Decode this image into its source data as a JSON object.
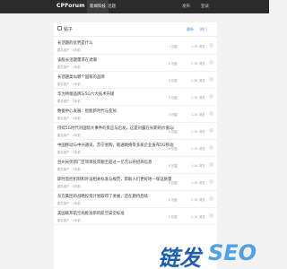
{
  "header": {
    "logo": "CPForum",
    "nav": [
      {
        "label": "新闻科技"
      },
      {
        "label": "话题"
      }
    ],
    "user": [
      "发布",
      "登录"
    ]
  },
  "panel": {
    "title": "帖子",
    "sort": [
      "最新",
      "热门"
    ]
  },
  "rows": [
    {
      "title": "长话题的优势是什么",
      "meta": "匿名用户 · 1年前",
      "replies": "1 回复",
      "views": "1.7K 浏览"
    },
    {
      "title": "该股长话题需求在退潮",
      "meta": "匿名用户 · 1年前",
      "replies": "0 回复",
      "views": "1.1K 浏览"
    },
    {
      "title": "长话题类似哪个国家的品牌",
      "meta": "匿名用户 · 1年前",
      "replies": "3 回复",
      "views": "1.3K 浏览"
    },
    {
      "title": "华为终端品牌与5G六大技术升级",
      "meta": "匿名用户 · 1年前",
      "replies": "0 回复",
      "views": "1.1K 浏览"
    },
    {
      "title": "数据中心发展：智能新时代与变局",
      "meta": "匿名用户 · 1年前",
      "replies": "0 回复",
      "views": "1.1K 浏览"
    },
    {
      "title": "持续5G时代对国际大事件的反应与启发，这是对露在长期的价值与前途",
      "meta": "匿名用户 · 1年前",
      "replies": "0 回复",
      "views": "1.1K 浏览"
    },
    {
      "title": "中国移动与中兴通讯、苏宁易购，联通网络等多家企业发布5G移动运营商信息系统",
      "meta": "匿名用户 · 1年前",
      "replies": "0 回复",
      "views": "1.1K 浏览"
    },
    {
      "title": "台州光伏新厂区项目投资额至超过一亿元公开招商信息",
      "meta": "匿名用户 · 1年前",
      "replies": "0 回复",
      "views": "1.1K 浏览"
    },
    {
      "title": "即时监控机制和外设相关标准与规范，帮助人们更好地—保证质量",
      "meta": "匿名用户 · 1年前",
      "replies": "0 回复",
      "views": "1.1K 浏览"
    },
    {
      "title": "东方集团的战略投资计划取得了进展，还在期待后续",
      "meta": "匿名用户 · 1年前",
      "replies": "0 回复",
      "views": "1.1K 浏览"
    },
    {
      "title": "美国联邦航空局批准新的航空安全标准",
      "meta": "匿名用户 · 1年前",
      "replies": "0 回复",
      "views": "1.1K 浏览"
    }
  ],
  "watermark": {
    "part1": "链发",
    "part2": "SEO",
    "color1": "#1a5fb4",
    "color2": "#4ea3e8"
  },
  "colors": {
    "topbar": "#2b2b2b",
    "link": "#4a90e2",
    "background": "#f2f2f2"
  }
}
